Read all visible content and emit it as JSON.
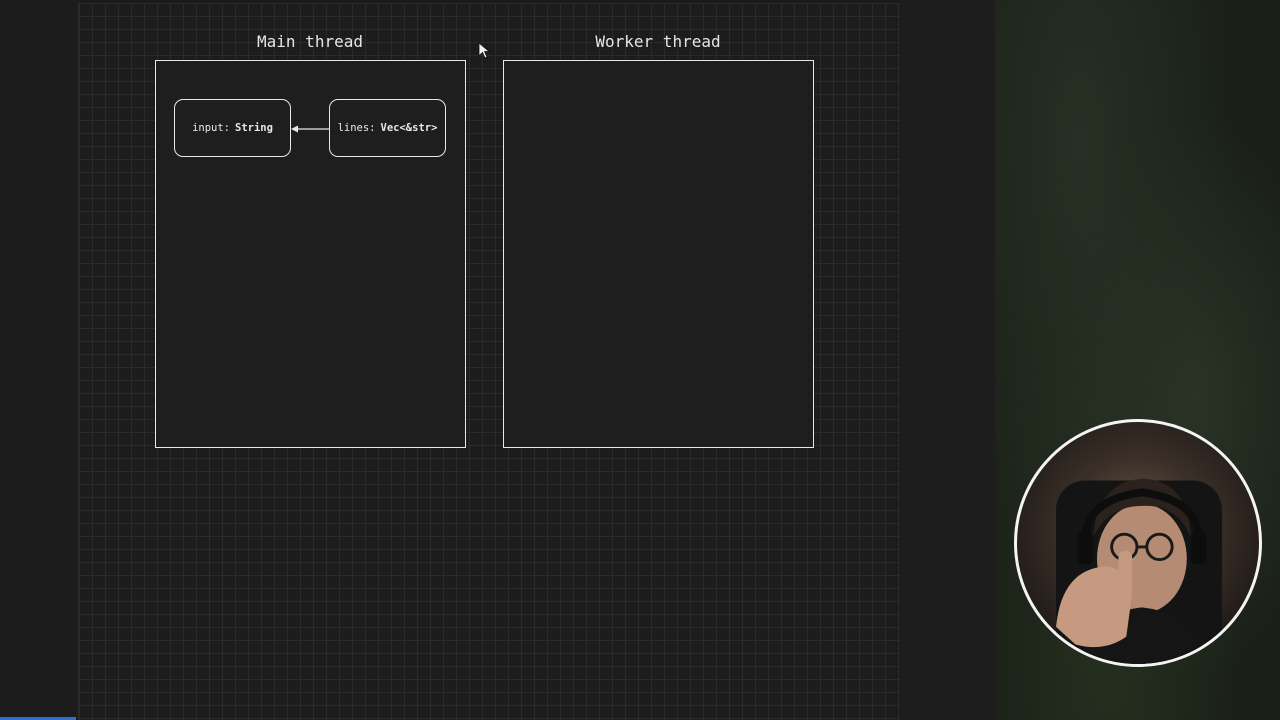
{
  "diagram": {
    "main_thread": {
      "title": "Main thread",
      "nodes": [
        {
          "name": "input:",
          "type": "String"
        },
        {
          "name": "lines:",
          "type": "Vec<&str>"
        }
      ]
    },
    "worker_thread": {
      "title": "Worker thread"
    }
  },
  "colors": {
    "canvas_bg": "#1c1c1c",
    "grid_line": "#2a2a2a",
    "stroke": "#e8e8e8",
    "accent_bar": "#2f6fd1"
  },
  "icons": {
    "cursor": "mouse-pointer-icon",
    "arrow": "arrow-left-icon"
  }
}
